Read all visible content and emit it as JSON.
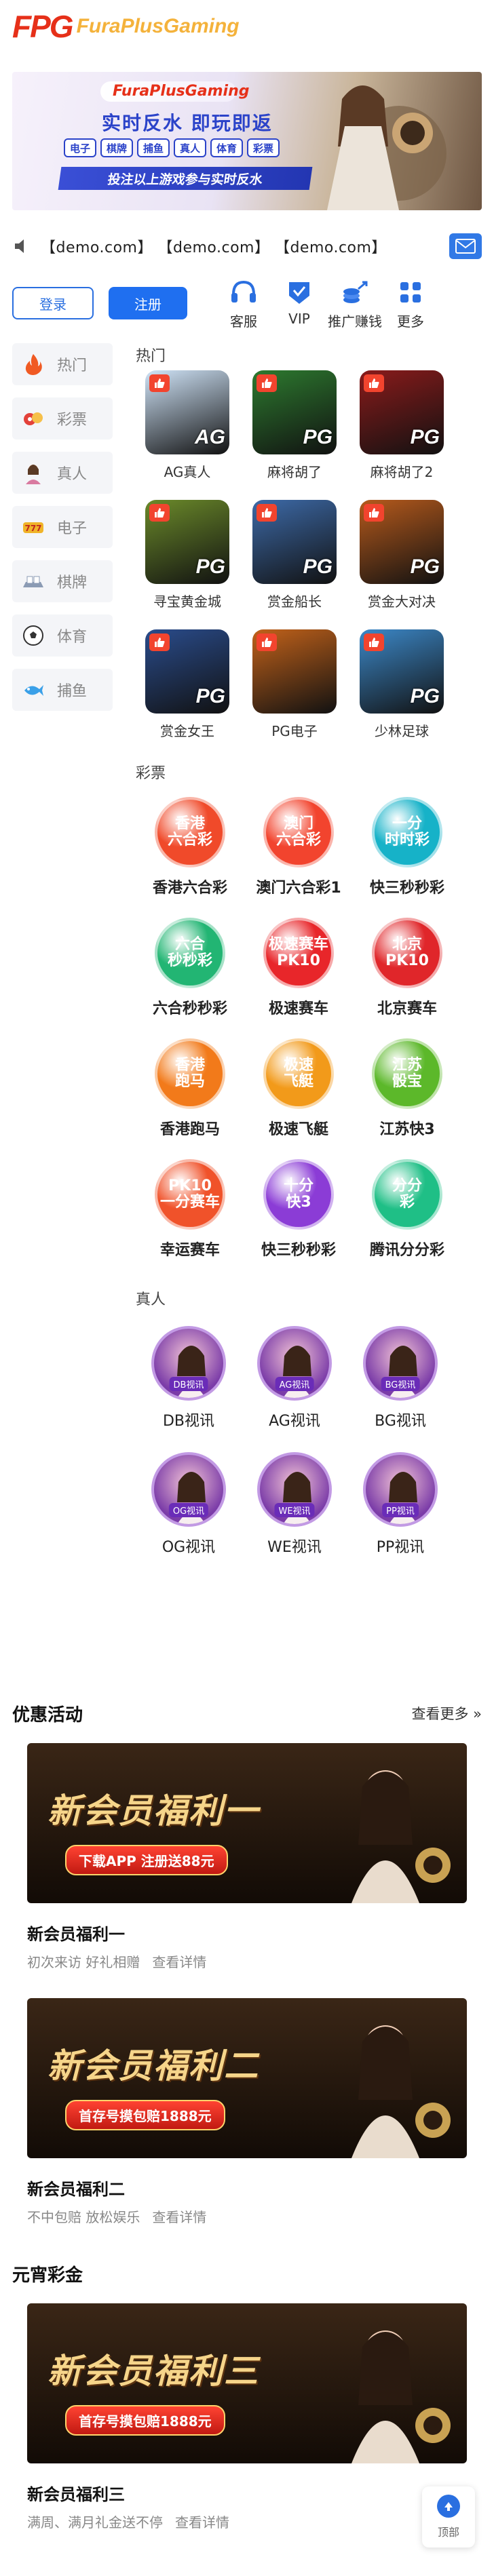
{
  "header": {
    "logo_mark": "FPG",
    "logo_name": "FuraPlusGaming"
  },
  "banner": {
    "logo_text": "FuraPlusGaming",
    "headline": "实时反水  即玩即返",
    "tags": [
      "电子",
      "棋牌",
      "捕鱼",
      "真人",
      "体育",
      "彩票"
    ],
    "strip": "投注以上游戏参与实时反水"
  },
  "notice": {
    "text": "【demo.com】 【demo.com】 【demo.com】"
  },
  "auth": {
    "login": "登录",
    "register": "注册"
  },
  "quick_links": [
    {
      "label": "客服",
      "icon": "headset-icon"
    },
    {
      "label": "VIP",
      "icon": "vip-icon"
    },
    {
      "label": "推广赚钱",
      "icon": "promote-icon"
    },
    {
      "label": "更多",
      "icon": "more-icon"
    }
  ],
  "sidebar": {
    "items": [
      {
        "label": "热门",
        "icon": "fire-icon",
        "color": "#f05a23"
      },
      {
        "label": "彩票",
        "icon": "lottery-icon",
        "color": "#e3413a"
      },
      {
        "label": "真人",
        "icon": "live-dealer-icon",
        "color": "#d97aa0"
      },
      {
        "label": "电子",
        "icon": "slot-icon",
        "color": "#f0b429"
      },
      {
        "label": "棋牌",
        "icon": "cards-icon",
        "color": "#8b9bb4"
      },
      {
        "label": "体育",
        "icon": "ball-icon",
        "color": "#333333"
      },
      {
        "label": "捕鱼",
        "icon": "fish-icon",
        "color": "#3aa0e8"
      }
    ]
  },
  "hot": {
    "title": "热门",
    "games": [
      {
        "label": "AG真人",
        "brand": "AG",
        "bg": "#cfe3f7"
      },
      {
        "label": "麻将胡了",
        "brand": "PG",
        "bg": "#2d7a2f"
      },
      {
        "label": "麻将胡了2",
        "brand": "PG",
        "bg": "#8a1b1b"
      },
      {
        "label": "寻宝黄金城",
        "brand": "PG",
        "bg": "#6b8a2a"
      },
      {
        "label": "赏金船长",
        "brand": "PG",
        "bg": "#3d6aa8"
      },
      {
        "label": "赏金大对决",
        "brand": "PG",
        "bg": "#b65a1c"
      },
      {
        "label": "赏金女王",
        "brand": "PG",
        "bg": "#2a4c8c"
      },
      {
        "label": "PG电子",
        "brand": "",
        "bg": "#c2621a"
      },
      {
        "label": "少林足球",
        "brand": "PG",
        "bg": "#3c88c8"
      }
    ]
  },
  "lottery": {
    "title": "彩票",
    "items": [
      {
        "label": "香港六合彩",
        "ball": "香港\n六合彩",
        "color": "#f04a2a"
      },
      {
        "label": "澳门六合彩1",
        "ball": "澳门\n六合彩",
        "color": "#f2442e"
      },
      {
        "label": "快三秒秒彩",
        "ball": "一分\n时时彩",
        "color": "#16b2c8"
      },
      {
        "label": "六合秒秒彩",
        "ball": "六合\n秒秒彩",
        "color": "#22b573"
      },
      {
        "label": "极速赛车",
        "ball": "极速赛车\nPK10",
        "color": "#e8262a"
      },
      {
        "label": "北京赛车",
        "ball": "北京\nPK10",
        "color": "#e0262a"
      },
      {
        "label": "香港跑马",
        "ball": "香港\n跑马",
        "color": "#f27a1a"
      },
      {
        "label": "极速飞艇",
        "ball": "极速\n飞艇",
        "color": "#f29a1a"
      },
      {
        "label": "江苏快3",
        "ball": "江苏\n骰宝",
        "color": "#5cb82a"
      },
      {
        "label": "幸运赛车",
        "ball": "PK10\n一分赛车",
        "color": "#f0522a"
      },
      {
        "label": "快三秒秒彩",
        "ball": "十分\n快3",
        "color": "#8b3cd6"
      },
      {
        "label": "腾讯分分彩",
        "ball": "分分\n彩",
        "color": "#1fbf86"
      }
    ]
  },
  "live": {
    "title": "真人",
    "items": [
      {
        "label": "DB视讯",
        "tag": "DB视讯"
      },
      {
        "label": "AG视讯",
        "tag": "AG视讯"
      },
      {
        "label": "BG视讯",
        "tag": "BG视讯"
      },
      {
        "label": "OG视讯",
        "tag": "OG视讯"
      },
      {
        "label": "WE视讯",
        "tag": "WE视讯"
      },
      {
        "label": "PP视讯",
        "tag": "PP视讯"
      }
    ]
  },
  "promotions": {
    "title": "优惠活动",
    "more": "查看更多",
    "cards": [
      {
        "banner_title": "新会员福利一",
        "banner_button": "下载APP 注册送88元",
        "name": "新会员福利一",
        "sub": "初次来访 好礼相赠",
        "detail": "查看详情"
      },
      {
        "banner_title": "新会员福利二",
        "banner_button": "首存号摸包赔1888元",
        "name": "新会员福利二",
        "sub": "不中包赔 放松娱乐",
        "detail": "查看详情"
      }
    ]
  },
  "lantern": {
    "title": "元宵彩金",
    "cards": [
      {
        "banner_title": "新会员福利三",
        "banner_button": "首存号摸包赔1888元",
        "name": "新会员福利三",
        "sub": "满周、满月礼金送不停",
        "detail": "查看详情"
      }
    ]
  },
  "back_to_top": {
    "label": "顶部"
  }
}
